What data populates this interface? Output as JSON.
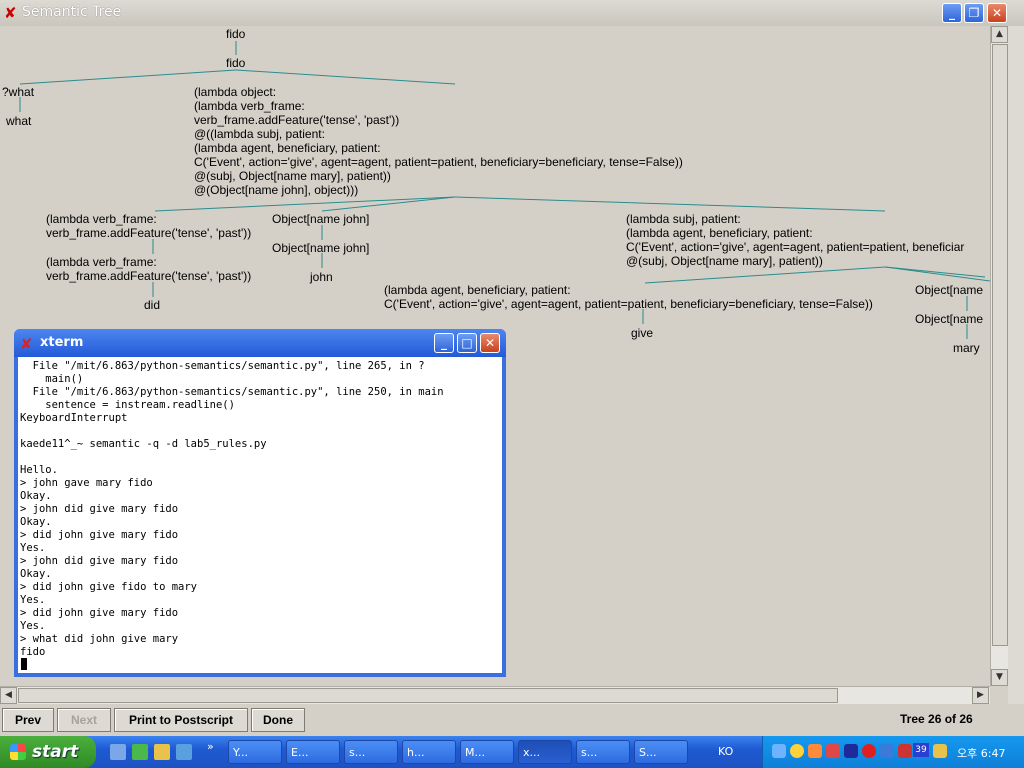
{
  "window": {
    "title": "Semantic Tree"
  },
  "tree": {
    "nodes": [
      "fido",
      "fido",
      "?what",
      "what",
      "(lambda object:\n(lambda verb_frame:\nverb_frame.addFeature('tense', 'past'))\n@((lambda subj, patient:\n(lambda agent, beneficiary, patient:\nC('Event', action='give', agent=agent, patient=patient, beneficiary=beneficiary, tense=False))\n@(subj, Object[name mary], patient))\n@(Object[name john], object)))",
      "(lambda verb_frame:\nverb_frame.addFeature('tense', 'past'))",
      "(lambda verb_frame:\nverb_frame.addFeature('tense', 'past'))",
      "did",
      "Object[name john]",
      "Object[name john]",
      "john",
      "(lambda subj, patient:\n(lambda agent, beneficiary, patient:\nC('Event', action='give', agent=agent, patient=patient, beneficiar\n@(subj, Object[name mary], patient))",
      "(lambda agent, beneficiary, patient:\nC('Event', action='give', agent=agent, patient=patient, beneficiary=beneficiary, tense=False))",
      "give",
      "Object[name",
      "Object[name",
      "mary"
    ]
  },
  "buttons": {
    "prev": "Prev",
    "next": "Next",
    "print": "Print to Postscript",
    "done": "Done"
  },
  "status": "Tree 26 of 26",
  "xterm": {
    "title": "xterm",
    "lines": [
      "  File \"/mit/6.863/python-semantics/semantic.py\", line 265, in ?",
      "    main()",
      "  File \"/mit/6.863/python-semantics/semantic.py\", line 250, in main",
      "    sentence = instream.readline()",
      "KeyboardInterrupt",
      "",
      "kaede11^_~ semantic -q -d lab5_rules.py",
      "",
      "Hello.",
      "> john gave mary fido",
      "Okay.",
      "> john did give mary fido",
      "Okay.",
      "> did john give mary fido",
      "Yes.",
      "> john did give mary fido",
      "Okay.",
      "> did john give fido to mary",
      "Yes.",
      "> did john give mary fido",
      "Yes.",
      "> what did john give mary",
      "fido"
    ]
  },
  "taskbar": {
    "start": "start",
    "items": [
      "Y...",
      "E...",
      "s...",
      "h...",
      "M...",
      "x...",
      "s...",
      "S..."
    ],
    "lang": "KO",
    "badge": "39",
    "clock": "오후 6:47"
  },
  "colors": {
    "tree_line": "#2a8c8c",
    "taskbar": "#245edb",
    "start": "#3c9a32"
  }
}
